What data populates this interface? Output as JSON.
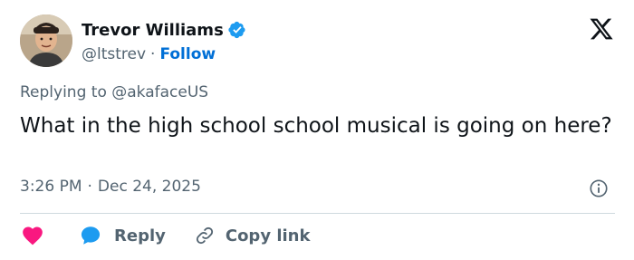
{
  "author": {
    "display_name": "Trevor Williams",
    "handle": "@ltstrev",
    "separator": "·",
    "follow_label": "Follow"
  },
  "reply_context": {
    "prefix": "Replying to ",
    "mention": "@akafaceUS"
  },
  "tweet": {
    "text": "What in the high school school musical is going on here?",
    "time": "3:26 PM",
    "separator": "·",
    "date": "Dec 24, 2025"
  },
  "actions": {
    "like_count": "",
    "reply_label": "Reply",
    "copy_link_label": "Copy link"
  },
  "colors": {
    "accent": "#006fd6",
    "like": "#f91880",
    "reply": "#1d9bf0",
    "secondary_text": "#536471"
  },
  "icons": [
    "verified-badge-icon",
    "x-logo-icon",
    "info-icon",
    "heart-icon",
    "reply-bubble-icon",
    "link-icon"
  ]
}
